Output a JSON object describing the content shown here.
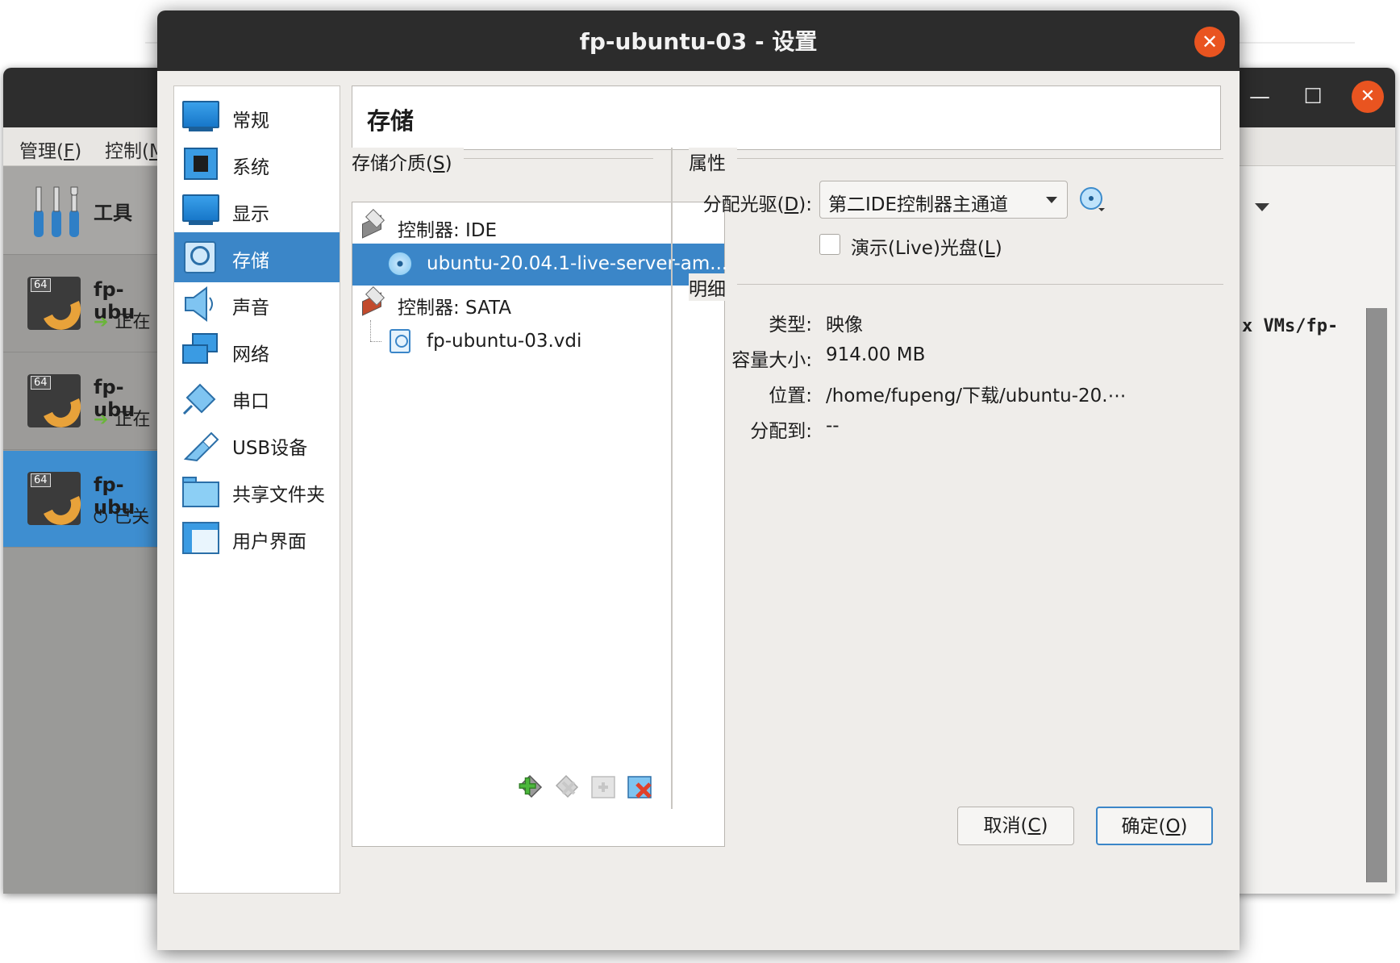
{
  "background_window": {
    "menus": [
      {
        "text": "管理(",
        "key": "F",
        "tail": ")"
      },
      {
        "text": "控制(",
        "key": "M",
        "tail": ""
      }
    ],
    "tools_label": "工具",
    "vms": [
      {
        "name": "fp-ubu",
        "badge": "64",
        "status": "正在"
      },
      {
        "name": "fp-ubu",
        "badge": "64",
        "status": "正在"
      },
      {
        "name": "fp-ubu",
        "badge": "64",
        "status": "已关"
      }
    ],
    "details_text": "x VMs/fp-"
  },
  "dialog": {
    "title": "fp-ubuntu-03 - 设置",
    "categories": [
      {
        "label": "常规",
        "icon": "general-icon"
      },
      {
        "label": "系统",
        "icon": "system-icon"
      },
      {
        "label": "显示",
        "icon": "display-icon"
      },
      {
        "label": "存储",
        "icon": "storage-icon"
      },
      {
        "label": "声音",
        "icon": "audio-icon"
      },
      {
        "label": "网络",
        "icon": "network-icon"
      },
      {
        "label": "串口",
        "icon": "serial-port-icon"
      },
      {
        "label": "USB设备",
        "icon": "usb-icon"
      },
      {
        "label": "共享文件夹",
        "icon": "shared-folder-icon"
      },
      {
        "label": "用户界面",
        "icon": "user-interface-icon"
      }
    ],
    "selected_category": "存储",
    "page_title": "存储",
    "storage": {
      "label_text": "存储介质(",
      "label_key": "S",
      "label_tail": ")",
      "tree": [
        {
          "type": "controller",
          "label": "控制器: IDE"
        },
        {
          "type": "optical",
          "label": "ubuntu-20.04.1-live-server-am..."
        },
        {
          "type": "controller",
          "label": "控制器: SATA"
        },
        {
          "type": "disk",
          "label": "fp-ubuntu-03.vdi"
        }
      ],
      "toolbar": [
        "add-attachment-icon",
        "remove-attachment-icon",
        "add-controller-icon",
        "remove-controller-icon"
      ]
    },
    "attributes": {
      "section_label": "属性",
      "drive_label_text": "分配光驱(",
      "drive_label_key": "D",
      "drive_label_tail": "):",
      "drive_value": "第二IDE控制器主通道",
      "live_cd_text": "演示(Live)光盘(",
      "live_cd_key": "L",
      "live_cd_tail": ")",
      "live_cd_checked": false
    },
    "details": {
      "section_label": "明细",
      "rows": [
        {
          "label": "类型:",
          "value": "映像"
        },
        {
          "label": "容量大小:",
          "value": "914.00 MB"
        },
        {
          "label": "位置:",
          "value": "/home/fupeng/下载/ubuntu-20.⋯"
        },
        {
          "label": "分配到:",
          "value": "--"
        }
      ]
    },
    "buttons": {
      "cancel_text": "取消(",
      "cancel_key": "C",
      "cancel_tail": ")",
      "ok_text": "确定(",
      "ok_key": "O",
      "ok_tail": ")"
    }
  },
  "colors": {
    "accent": "#3b86c8",
    "close": "#e95420",
    "titlebar": "#2c2c2c"
  }
}
